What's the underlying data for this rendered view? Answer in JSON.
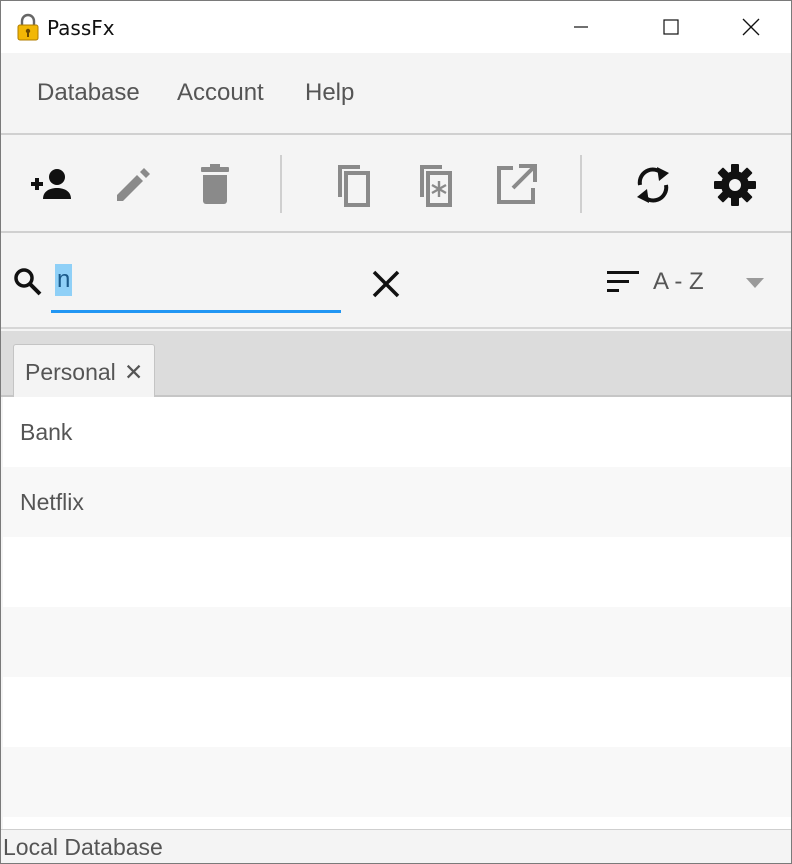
{
  "window": {
    "title": "PassFx",
    "controls": {
      "minimize_icon": "minimize-icon",
      "maximize_icon": "maximize-icon",
      "close_icon": "close-icon"
    }
  },
  "menubar": {
    "items": [
      {
        "label": "Database"
      },
      {
        "label": "Account"
      },
      {
        "label": "Help"
      }
    ]
  },
  "toolbar": {
    "buttons": [
      {
        "icon": "add-user-icon",
        "enabled": true
      },
      {
        "icon": "edit-icon",
        "enabled": false
      },
      {
        "icon": "delete-icon",
        "enabled": false
      },
      {
        "icon": "copy-username-icon",
        "enabled": false
      },
      {
        "icon": "copy-password-icon",
        "enabled": false
      },
      {
        "icon": "open-url-icon",
        "enabled": false
      },
      {
        "icon": "sync-icon",
        "enabled": true
      },
      {
        "icon": "settings-icon",
        "enabled": true
      }
    ]
  },
  "search": {
    "value": "n",
    "sort_label": "A - Z"
  },
  "tabs": [
    {
      "label": "Personal",
      "close": "✕"
    }
  ],
  "list": {
    "items": [
      "Bank",
      "Netflix",
      "",
      "",
      "",
      ""
    ]
  },
  "status": {
    "text": "Local Database"
  },
  "colors": {
    "accent": "#2196f3",
    "selection": "#8fd0f7",
    "icon_active": "#111111",
    "icon_disabled": "#8a8a8a"
  }
}
